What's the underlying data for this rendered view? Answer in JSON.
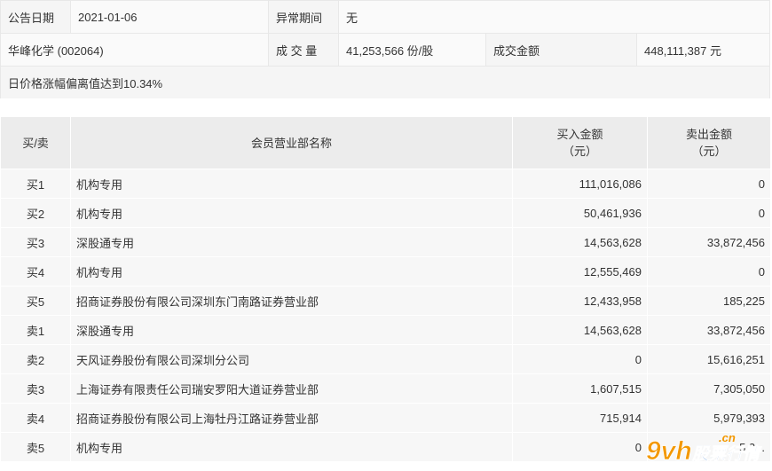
{
  "announcement": {
    "date_label": "公告日期",
    "date_value": "2021-01-06",
    "abnormal_label": "异常期间",
    "abnormal_value": "无",
    "stock": "华峰化学 (002064)",
    "volume_label": "成 交 量",
    "volume_value": "41,253,566 份/股",
    "turnover_label": "成交金额",
    "turnover_value": "448,111,387 元",
    "reason": "日价格涨幅偏离值达到10.34%"
  },
  "table": {
    "headers": {
      "side": "买/卖",
      "name": "会员营业部名称",
      "buy": [
        "买入金额",
        "（元）"
      ],
      "sell": [
        "卖出金额",
        "（元）"
      ]
    },
    "rows": [
      {
        "side": "买1",
        "name": "机构专用",
        "buy": "111,016,086",
        "sell": "0"
      },
      {
        "side": "买2",
        "name": "机构专用",
        "buy": "50,461,936",
        "sell": "0"
      },
      {
        "side": "买3",
        "name": "深股通专用",
        "buy": "14,563,628",
        "sell": "33,872,456"
      },
      {
        "side": "买4",
        "name": "机构专用",
        "buy": "12,555,469",
        "sell": "0"
      },
      {
        "side": "买5",
        "name": "招商证券股份有限公司深圳东门南路证券营业部",
        "buy": "12,433,958",
        "sell": "185,225"
      },
      {
        "side": "卖1",
        "name": "深股通专用",
        "buy": "14,563,628",
        "sell": "33,872,456"
      },
      {
        "side": "卖2",
        "name": "天风证券股份有限公司深圳分公司",
        "buy": "0",
        "sell": "15,616,251"
      },
      {
        "side": "卖3",
        "name": "上海证券有限责任公司瑞安罗阳大道证券营业部",
        "buy": "1,607,515",
        "sell": "7,305,050"
      },
      {
        "side": "卖4",
        "name": "招商证券股份有限公司上海牡丹江路证券营业部",
        "buy": "715,914",
        "sell": "5,979,393"
      },
      {
        "side": "卖5",
        "name": "机构专用",
        "buy": "0",
        "sell": "5,3..."
      }
    ]
  },
  "watermark": {
    "logo_text": "9vh",
    "domain": ".cn",
    "tagline": "股票行情",
    "colors": {
      "orange": "#f39800",
      "blue": "#2a6ec9"
    }
  }
}
